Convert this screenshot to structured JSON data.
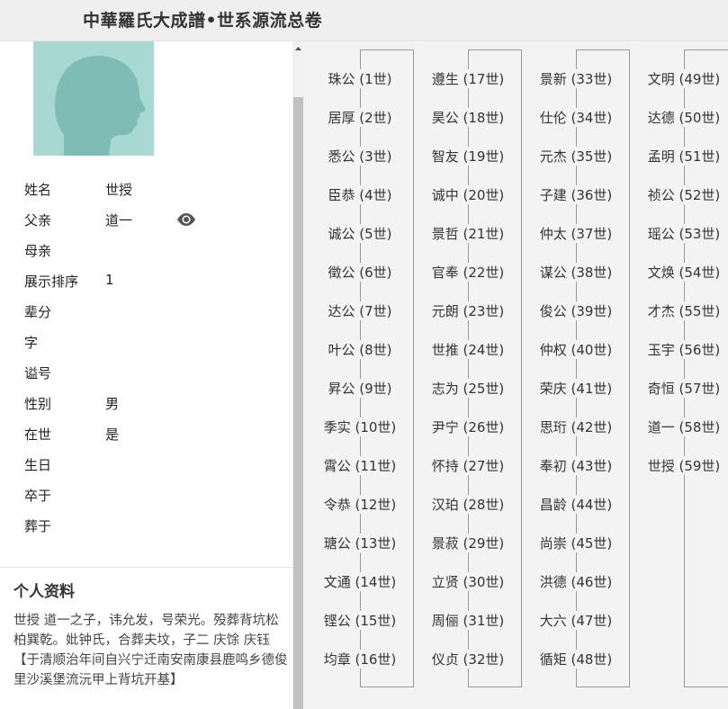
{
  "header": {
    "title": "中華羅氏大成譜•世系源流总卷"
  },
  "person": {
    "fields": [
      {
        "label": "姓名",
        "value": "世授"
      },
      {
        "label": "父亲",
        "value": "道一"
      },
      {
        "label": "母亲",
        "value": ""
      },
      {
        "label": "展示排序",
        "value": "1"
      },
      {
        "label": "辈分",
        "value": ""
      },
      {
        "label": "字",
        "value": ""
      },
      {
        "label": "谥号",
        "value": ""
      },
      {
        "label": "性别",
        "value": "男"
      },
      {
        "label": "在世",
        "value": "是"
      },
      {
        "label": "生日",
        "value": ""
      },
      {
        "label": "卒于",
        "value": ""
      },
      {
        "label": "葬于",
        "value": ""
      }
    ]
  },
  "profile": {
    "title": "个人资料",
    "line1": "世授  道一之子，讳允发，号荣光。殁葬背坑松柏巽乾。妣钟氏，合葬夫坟，子二  庆馀  庆钰",
    "line2": "【于清顺治年间自兴宁迁南安南康县鹿鸣乡德俊里沙溪堡流沅甲上背坑开基】"
  },
  "generations": [
    "珠公 (1世)",
    "居厚 (2世)",
    "悉公 (3世)",
    "臣恭 (4世)",
    "诚公 (5世)",
    "徵公 (6世)",
    "达公 (7世)",
    "叶公 (8世)",
    "昇公 (9世)",
    "季实 (10世)",
    "霄公 (11世)",
    "令恭 (12世)",
    "瑭公 (13世)",
    "文通 (14世)",
    "铿公 (15世)",
    "均章 (16世)",
    "遵生 (17世)",
    "昊公 (18世)",
    "智友 (19世)",
    "诚中 (20世)",
    "景哲 (21世)",
    "官奉 (22世)",
    "元朗 (23世)",
    "世推 (24世)",
    "志为 (25世)",
    "尹宁 (26世)",
    "怀持 (27世)",
    "汉珀 (28世)",
    "景菽 (29世)",
    "立贤 (30世)",
    "周俪 (31世)",
    "仪贞 (32世)",
    "景新 (33世)",
    "仕伦 (34世)",
    "元杰 (35世)",
    "子建 (36世)",
    "仲太 (37世)",
    "谋公 (38世)",
    "俊公 (39世)",
    "仲权 (40世)",
    "荣庆 (41世)",
    "思珩 (42世)",
    "奉初 (43世)",
    "昌龄 (44世)",
    "尚崇 (45世)",
    "洪德 (46世)",
    "大六 (47世)",
    "循矩 (48世)",
    "文明 (49世)",
    "达德 (50世)",
    "孟明 (51世)",
    "祯公 (52世)",
    "瑶公 (53世)",
    "文焕 (54世)",
    "才杰 (55世)",
    "玉宇 (56世)",
    "奇恒 (57世)",
    "道一 (58世)",
    "世授 (59世)"
  ]
}
